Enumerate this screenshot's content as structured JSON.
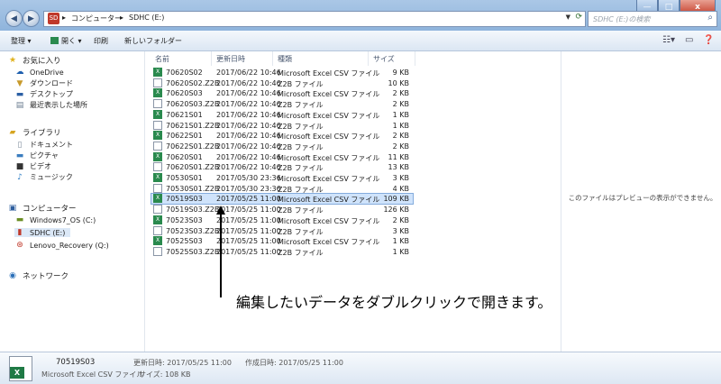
{
  "window": {
    "min": "—",
    "max": "□",
    "close": "x"
  },
  "address": {
    "breadcrumbs": [
      "コンピューター",
      "SDHC (E:)"
    ],
    "separator": "▸",
    "search_placeholder": "SDHC (E:)の検索"
  },
  "toolbar": {
    "organize": "整理 ▾",
    "open": "開く ▾",
    "print": "印刷",
    "new_folder": "新しいフォルダー"
  },
  "sidebar": {
    "favorites": {
      "label": "お気に入り",
      "items": [
        "OneDrive",
        "ダウンロード",
        "デスクトップ",
        "最近表示した場所"
      ]
    },
    "libraries": {
      "label": "ライブラリ",
      "items": [
        "ドキュメント",
        "ピクチャ",
        "ビデオ",
        "ミュージック"
      ]
    },
    "computer": {
      "label": "コンピューター",
      "items": [
        "Windows7_OS (C:)",
        "SDHC (E:)",
        "Lenovo_Recovery (Q:)"
      ]
    },
    "network": {
      "label": "ネットワーク"
    }
  },
  "columns": {
    "name": "名前",
    "date": "更新日時",
    "type": "種類",
    "size": "サイズ"
  },
  "files": [
    {
      "name": "70620S02",
      "date": "2017/06/22 10:46",
      "type": "Microsoft Excel CSV ファイル",
      "size": "9 KB",
      "kind": "csv"
    },
    {
      "name": "70620S02.Z2B",
      "date": "2017/06/22 10:46",
      "type": "Z2B ファイル",
      "size": "10 KB",
      "kind": "doc"
    },
    {
      "name": "70620S03",
      "date": "2017/06/22 10:46",
      "type": "Microsoft Excel CSV ファイル",
      "size": "2 KB",
      "kind": "csv"
    },
    {
      "name": "70620S03.Z2B",
      "date": "2017/06/22 10:46",
      "type": "Z2B ファイル",
      "size": "2 KB",
      "kind": "doc"
    },
    {
      "name": "70621S01",
      "date": "2017/06/22 10:46",
      "type": "Microsoft Excel CSV ファイル",
      "size": "1 KB",
      "kind": "csv"
    },
    {
      "name": "70621S01.Z2B",
      "date": "2017/06/22 10:46",
      "type": "Z2B ファイル",
      "size": "1 KB",
      "kind": "doc"
    },
    {
      "name": "70622S01",
      "date": "2017/06/22 10:46",
      "type": "Microsoft Excel CSV ファイル",
      "size": "2 KB",
      "kind": "csv"
    },
    {
      "name": "70622S01.Z2B",
      "date": "2017/06/22 10:46",
      "type": "Z2B ファイル",
      "size": "2 KB",
      "kind": "doc"
    },
    {
      "name": "70620S01",
      "date": "2017/06/22 10:46",
      "type": "Microsoft Excel CSV ファイル",
      "size": "11 KB",
      "kind": "csv"
    },
    {
      "name": "70620S01.Z2B",
      "date": "2017/06/22 10:46",
      "type": "Z2B ファイル",
      "size": "13 KB",
      "kind": "doc"
    },
    {
      "name": "70530S01",
      "date": "2017/05/30 23:36",
      "type": "Microsoft Excel CSV ファイル",
      "size": "3 KB",
      "kind": "csv"
    },
    {
      "name": "70530S01.Z2B",
      "date": "2017/05/30 23:36",
      "type": "Z2B ファイル",
      "size": "4 KB",
      "kind": "doc"
    },
    {
      "name": "70519S03",
      "date": "2017/05/25 11:00",
      "type": "Microsoft Excel CSV ファイル",
      "size": "109 KB",
      "kind": "csv",
      "selected": true
    },
    {
      "name": "70519S03.Z2B",
      "date": "2017/05/25 11:00",
      "type": "Z2B ファイル",
      "size": "126 KB",
      "kind": "doc"
    },
    {
      "name": "70523S03",
      "date": "2017/05/25 11:00",
      "type": "Microsoft Excel CSV ファイル",
      "size": "2 KB",
      "kind": "csv"
    },
    {
      "name": "70523S03.Z2B",
      "date": "2017/05/25 11:00",
      "type": "Z2B ファイル",
      "size": "3 KB",
      "kind": "doc"
    },
    {
      "name": "70525S03",
      "date": "2017/05/25 11:00",
      "type": "Microsoft Excel CSV ファイル",
      "size": "1 KB",
      "kind": "csv"
    },
    {
      "name": "70525S03.Z2B",
      "date": "2017/05/25 11:00",
      "type": "Z2B ファイル",
      "size": "1 KB",
      "kind": "doc"
    }
  ],
  "preview": {
    "message": "このファイルはプレビューの表示ができません。"
  },
  "annotation": {
    "text": "編集したいデータをダブルクリックで開きます。"
  },
  "details": {
    "name": "70519S03",
    "type": "Microsoft Excel CSV ファイル",
    "modified": "更新日時: 2017/05/25 11:00",
    "created": "作成日時: 2017/05/25 11:00",
    "size": "サイズ: 108 KB"
  },
  "colors": {
    "selection": "#cfe3fb",
    "titlebar": "#9fbde0",
    "close": "#c6402c"
  }
}
